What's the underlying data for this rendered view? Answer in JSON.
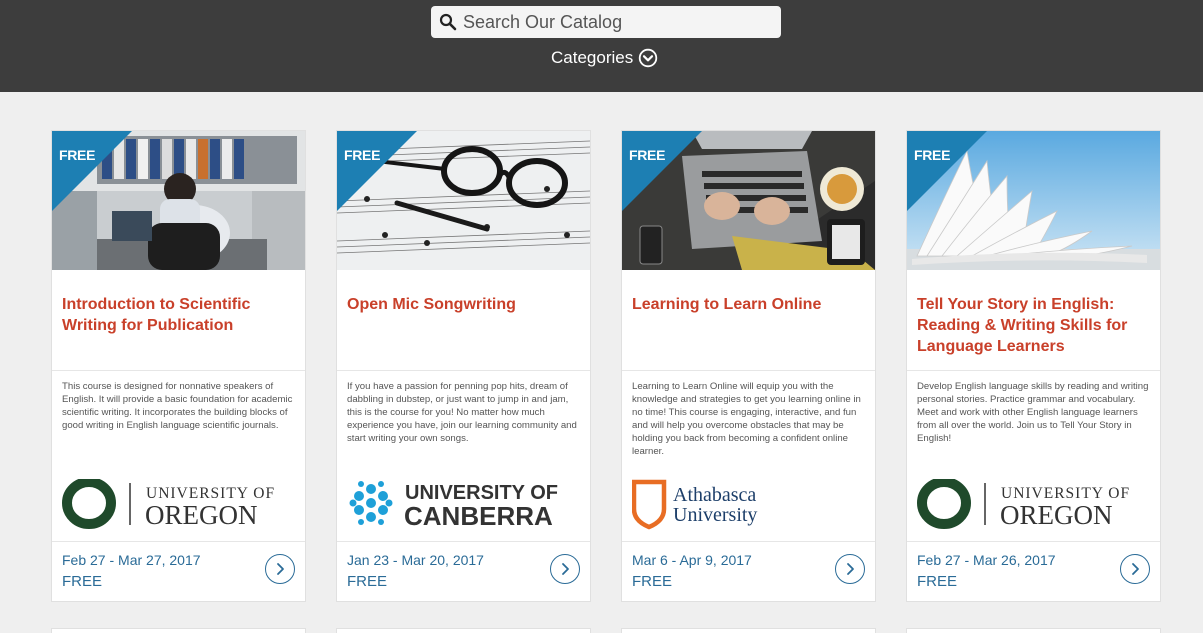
{
  "header": {
    "search_placeholder": "Search Our Catalog",
    "categories_label": "Categories"
  },
  "colors": {
    "header_bg": "#3d3d3d",
    "title_red": "#c9402a",
    "accent_blue": "#2a6b97",
    "ribbon_blue": "#1d7fb3",
    "oregon_green": "#1f4a2b",
    "canberra_blue": "#1ea0d8",
    "athabasca_orange": "#e86d24"
  },
  "courses": [
    {
      "ribbon": "FREE",
      "title": "Introduction to Scientific Writing for Publication",
      "description": "This course is designed for nonnative speakers of English. It will provide a basic foundation for academic scientific writing. It incorporates the building blocks of good writing in English language scientific journals.",
      "logo": {
        "line1": "UNIVERSITY OF",
        "line2": "OREGON",
        "mark": "O"
      },
      "dates": "Feb 27 - Mar 27, 2017",
      "price": "FREE"
    },
    {
      "ribbon": "FREE",
      "title": "Open Mic Songwriting",
      "description": "If you have a passion for penning pop hits, dream of dabbling in dubstep, or just want to jump in and jam, this is the course for you! No matter how much experience you have, join our learning community and start writing your own songs.",
      "logo": {
        "line1": "UNIVERSITY OF",
        "line2": "CANBERRA"
      },
      "dates": "Jan 23 - Mar 20, 2017",
      "price": "FREE"
    },
    {
      "ribbon": "FREE",
      "title": "Learning to Learn Online",
      "description": "Learning to Learn Online will equip you with the knowledge and strategies to get you learning online in no time! This course is engaging, interactive, and fun and will help you overcome obstacles that may be holding you back from becoming a confident online learner.",
      "logo": {
        "line1": "Athabasca",
        "line2": "University"
      },
      "dates": "Mar 6 - Apr 9, 2017",
      "price": "FREE"
    },
    {
      "ribbon": "FREE",
      "title": "Tell Your Story in English: Reading & Writing Skills for Language Learners",
      "description": "Develop English language skills by reading and writing personal stories. Practice grammar and vocabulary. Meet and work with other English language learners from all over the world. Join us to Tell Your Story in English!",
      "logo": {
        "line1": "UNIVERSITY OF",
        "line2": "OREGON",
        "mark": "O"
      },
      "dates": "Feb 27 - Mar 26, 2017",
      "price": "FREE"
    }
  ]
}
